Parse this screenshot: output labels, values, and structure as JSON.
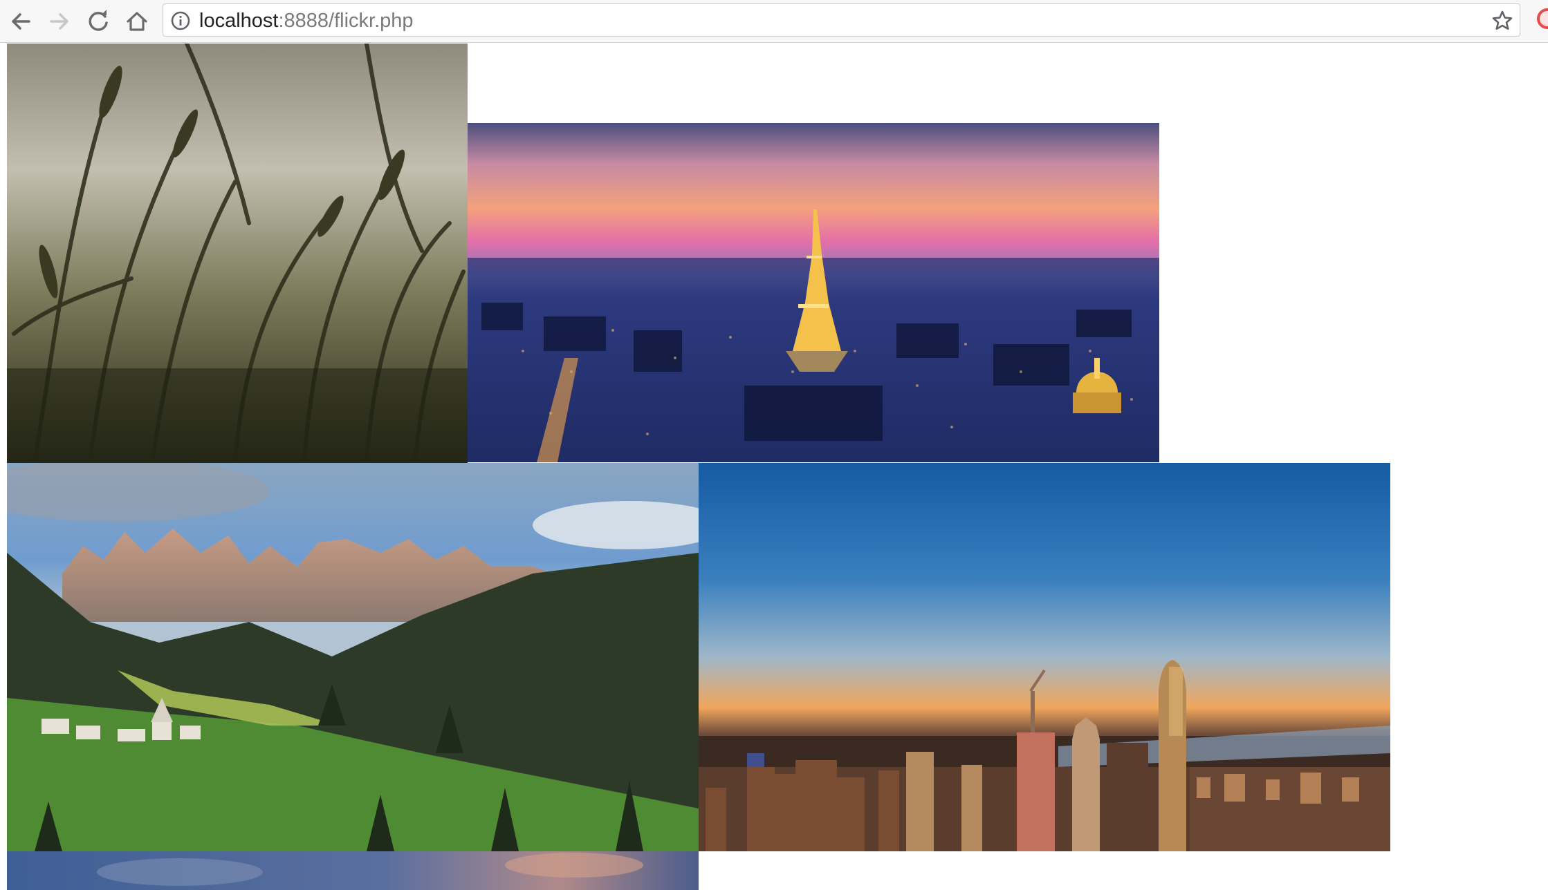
{
  "browser": {
    "back_icon": "arrow-left-icon",
    "forward_icon": "arrow-right-icon",
    "reload_icon": "reload-icon",
    "home_icon": "home-icon",
    "info_icon": "info-circle-icon",
    "bookmark_icon": "star-icon",
    "url_host": "localhost",
    "url_rest": ":8888/flickr.php"
  },
  "gallery": {
    "photos": [
      {
        "subject": "wheat-grass-closeup",
        "colors": [
          "#b9b4a6",
          "#3a3a22"
        ]
      },
      {
        "subject": "paris-eiffel-tower-night",
        "colors": [
          "#e66ea8",
          "#1d2f7a"
        ]
      },
      {
        "subject": "dolomites-mountain-village",
        "colors": [
          "#6f9ccf",
          "#3f6e2a"
        ]
      },
      {
        "subject": "new-york-skyline-sunset",
        "colors": [
          "#1d5ea5",
          "#f0a65c"
        ]
      },
      {
        "subject": "mountain-dusk-partial",
        "colors": [
          "#3e5f95",
          "#b08a8a"
        ]
      }
    ]
  }
}
